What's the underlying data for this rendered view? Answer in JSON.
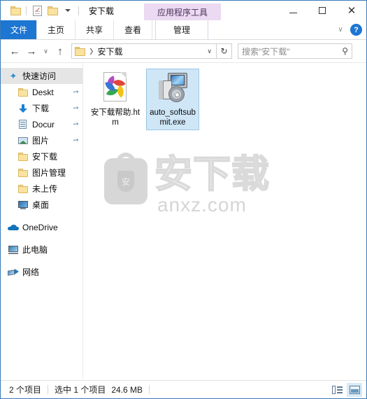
{
  "window": {
    "title": "安下载",
    "contextual_tab_header": "应用程序工具",
    "quick_access_toolbar": [
      {
        "name": "folder-properties",
        "icon": "folder-icon"
      },
      {
        "name": "properties",
        "icon": "properties-icon"
      },
      {
        "name": "new-folder",
        "icon": "folder-icon"
      },
      {
        "name": "customize",
        "icon": "chevron-down-icon"
      }
    ],
    "controls": {
      "minimize": "—",
      "maximize": "□",
      "close": "✕"
    }
  },
  "ribbon": {
    "tabs": [
      {
        "label": "文件",
        "selected": true
      },
      {
        "label": "主页",
        "selected": false
      },
      {
        "label": "共享",
        "selected": false
      },
      {
        "label": "查看",
        "selected": false
      }
    ],
    "contextual_tab": {
      "label": "管理"
    },
    "collapse_label": "∨",
    "help_label": "?"
  },
  "navigation": {
    "back": "←",
    "forward": "→",
    "recent": "∨",
    "up": "↑",
    "address": {
      "folder_icon": "folder-icon",
      "separator": "❯",
      "text": "安下载",
      "dropdown": "∨"
    },
    "refresh": "↻",
    "search": {
      "placeholder": "搜索\"安下载\"",
      "icon": "⚲"
    }
  },
  "sidebar": {
    "items": [
      {
        "label": "快速访问",
        "icon": "star-icon",
        "selected": true,
        "indent": false,
        "pinned": false
      },
      {
        "label": "Deskt",
        "icon": "folder-icon",
        "selected": false,
        "indent": true,
        "pinned": true
      },
      {
        "label": "下载",
        "icon": "download-icon",
        "selected": false,
        "indent": true,
        "pinned": true
      },
      {
        "label": "Docur",
        "icon": "documents-icon",
        "selected": false,
        "indent": true,
        "pinned": true
      },
      {
        "label": "图片",
        "icon": "pictures-icon",
        "selected": false,
        "indent": true,
        "pinned": true
      },
      {
        "label": "安下载",
        "icon": "folder-icon",
        "selected": false,
        "indent": true,
        "pinned": false
      },
      {
        "label": "图片管理",
        "icon": "folder-icon",
        "selected": false,
        "indent": true,
        "pinned": false
      },
      {
        "label": "未上传",
        "icon": "folder-icon",
        "selected": false,
        "indent": true,
        "pinned": false
      },
      {
        "label": "桌面",
        "icon": "monitor-icon",
        "selected": false,
        "indent": true,
        "pinned": false
      },
      {
        "label": "OneDrive",
        "icon": "cloud-icon",
        "selected": false,
        "indent": false,
        "pinned": false
      },
      {
        "label": "此电脑",
        "icon": "this-pc-icon",
        "selected": false,
        "indent": false,
        "pinned": false
      },
      {
        "label": "网络",
        "icon": "network-icon",
        "selected": false,
        "indent": false,
        "pinned": false
      }
    ],
    "pin_glyph": "📌"
  },
  "files": [
    {
      "name": "安下载帮助.htm",
      "icon": "html-file-icon",
      "selected": false
    },
    {
      "name": "auto_softsubmit.exe",
      "icon": "exe-installer-icon",
      "selected": true
    }
  ],
  "watermark": {
    "title": "安下载",
    "subtitle": "anxz.com",
    "badge_char": "安"
  },
  "status": {
    "item_count": "2 个项目",
    "selection": "选中 1 个项目",
    "size": "24.6 MB",
    "views": [
      {
        "name": "details-view",
        "active": false
      },
      {
        "name": "large-icons-view",
        "active": true
      }
    ]
  },
  "colors": {
    "accent": "#1c76d2",
    "contextual_tab": "#ecd9f2",
    "selection": "#cfe6f7",
    "window_border": "#3a7cb8"
  }
}
